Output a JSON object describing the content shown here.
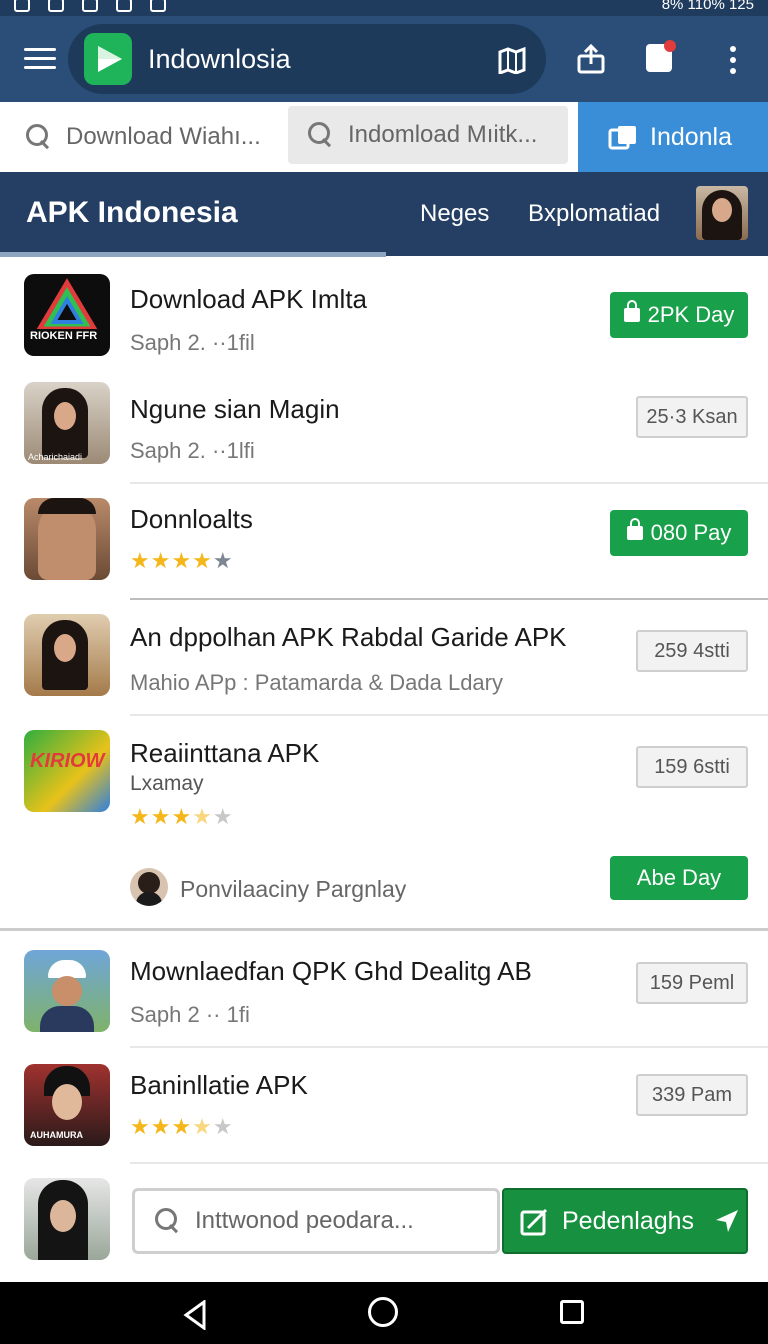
{
  "status_bar": {
    "right_text": "8%  110%  125"
  },
  "app_bar": {
    "title": "Indownlosia"
  },
  "search_row": {
    "field1_placeholder": "Download Wiahı...",
    "field2_placeholder": "Indomload Mıitk...",
    "tab_label": "Indonla"
  },
  "nav": {
    "title": "APK Indonesia",
    "link1": "Neges",
    "link2": "Bxplomatiad"
  },
  "items": [
    {
      "title": "Download APK Imlta",
      "subtitle": "Saph 2. ··1fil",
      "action": "2PK Day",
      "action_type": "green",
      "thumb_label": "RIOKEN FFR"
    },
    {
      "title": "Ngune sian Magin",
      "subtitle": "Saph 2. ··1lfi",
      "action": "25·3 Ksan",
      "action_type": "grey",
      "thumb_label": "Acharichaiadi"
    },
    {
      "title": "Donnloalts",
      "rating": 4,
      "action": "080 Pay",
      "action_type": "green"
    },
    {
      "title": "An dppolhan APK Rabdal Garide APK",
      "subtitle": "Mahio APp : Patamarda & Dada Ldary",
      "action": "259 4stti",
      "action_type": "grey"
    },
    {
      "title": "Reaiinttana APK",
      "subtitle": "Lxamay",
      "rating": 3.5,
      "action": "159 6stti",
      "action_type": "grey",
      "thumb_label": "KIRIOW"
    },
    {
      "title": "Mownlaedfan QPK Ghd Dealitg AB",
      "subtitle": "Saph 2 ·· 1fi",
      "action": "159 Peml",
      "action_type": "grey"
    },
    {
      "title": "Baninllatie APK",
      "rating": 3.5,
      "action": "339 Pam",
      "action_type": "grey",
      "thumb_label": "AUHAMURA"
    }
  ],
  "promo": {
    "text": "Ponvilaaciny Pargnlay",
    "action": "Abe Day"
  },
  "bottom": {
    "search_placeholder": "Inttwonod peodara...",
    "button_label": "Pedenlaghs"
  },
  "colors": {
    "appbar": "#2a4e78",
    "nav": "#243f63",
    "accent_blue": "#3a8ed8",
    "green": "#19a04a"
  }
}
